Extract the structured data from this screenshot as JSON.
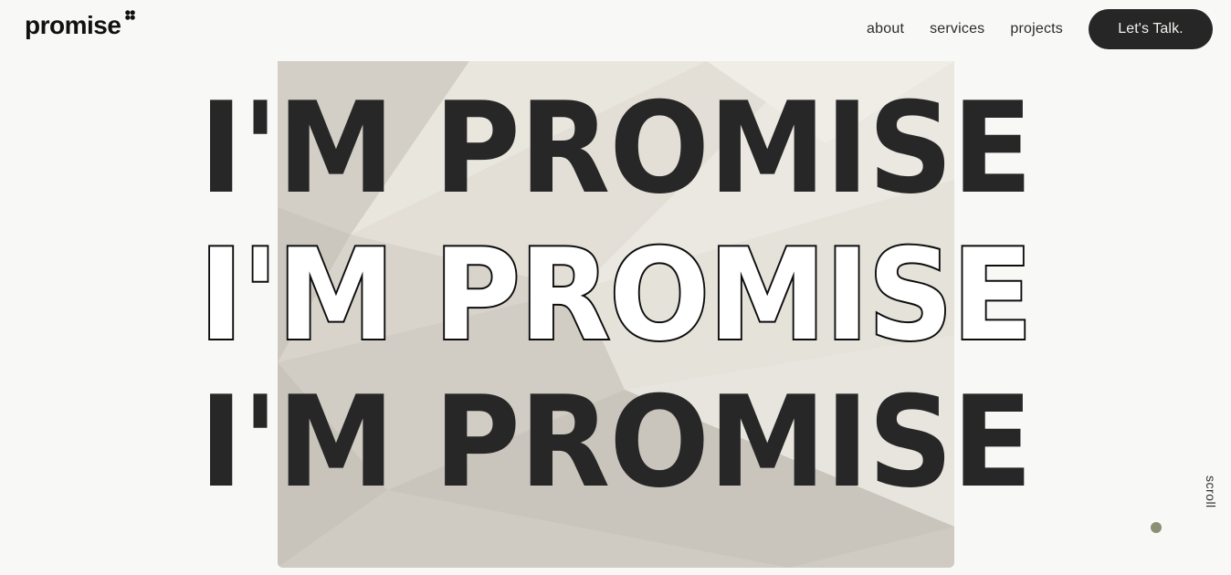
{
  "header": {
    "logo_text": "promise",
    "logo_icon": "four-dot-cluster-icon",
    "nav": [
      {
        "label": "about"
      },
      {
        "label": "services"
      },
      {
        "label": "projects"
      }
    ],
    "cta_label": "Let's Talk."
  },
  "hero": {
    "lines": [
      {
        "text": "I'M PROMISE",
        "style": "filled"
      },
      {
        "text": "I'M PROMISE",
        "style": "outline"
      },
      {
        "text": "I'M PROMISE",
        "style": "filled"
      }
    ]
  },
  "scroll": {
    "label": "scroll"
  },
  "colors": {
    "background": "#f8f8f6",
    "text": "#272727",
    "cta_bg": "#262626",
    "cta_text": "#f2f2ee",
    "scroll_dot": "#8c8f74",
    "image_tone": "#dedad2"
  }
}
